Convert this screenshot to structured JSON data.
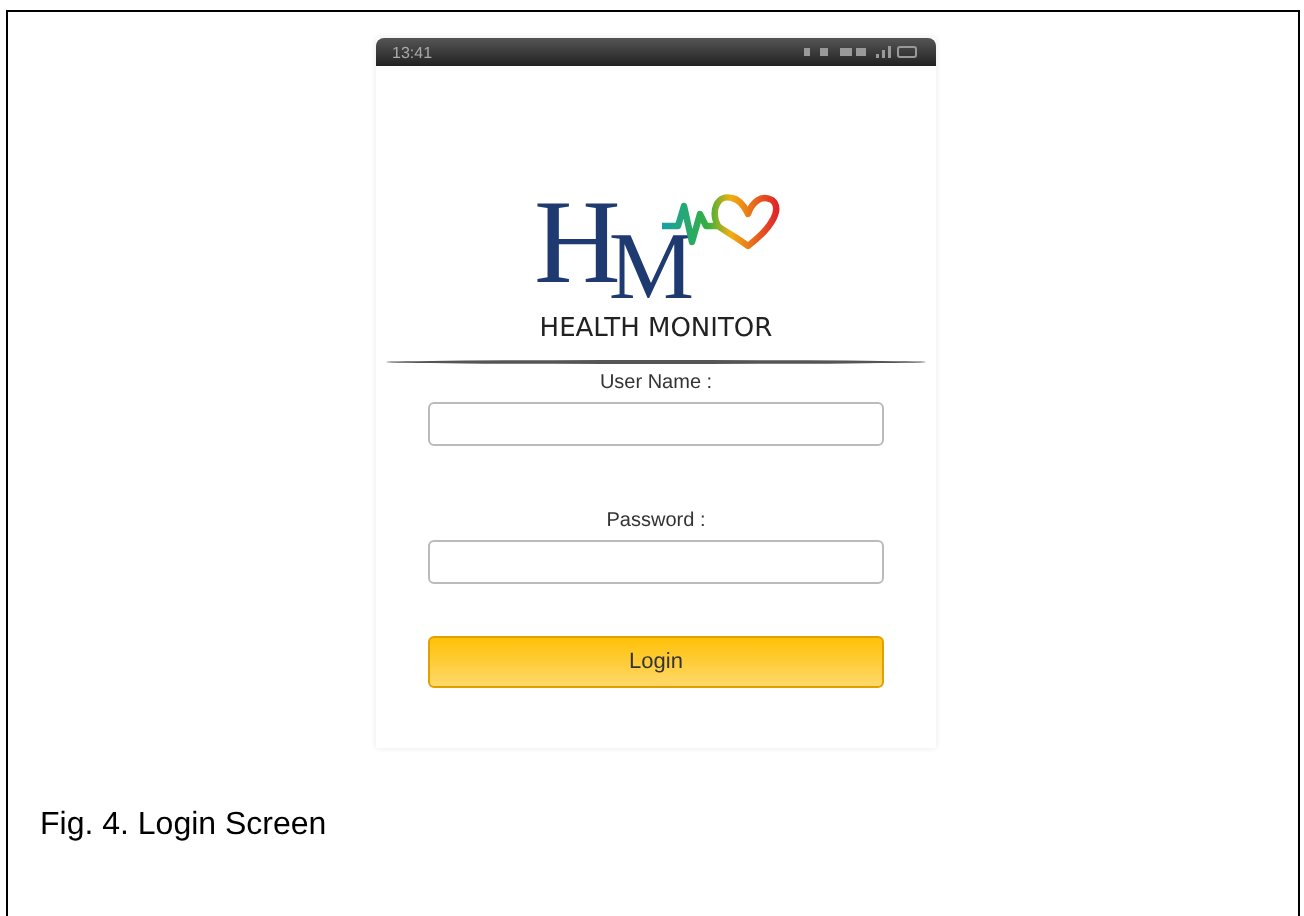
{
  "phone": {
    "status_bar": {
      "time": "13:41"
    },
    "logo": {
      "letters": [
        "H",
        "M"
      ],
      "name": "HEALTH MONITOR"
    },
    "fields": [
      {
        "label": "User Name :"
      },
      {
        "label": "Password :"
      }
    ],
    "login_button": "Login"
  },
  "caption": "Fig. 4. Login Screen"
}
